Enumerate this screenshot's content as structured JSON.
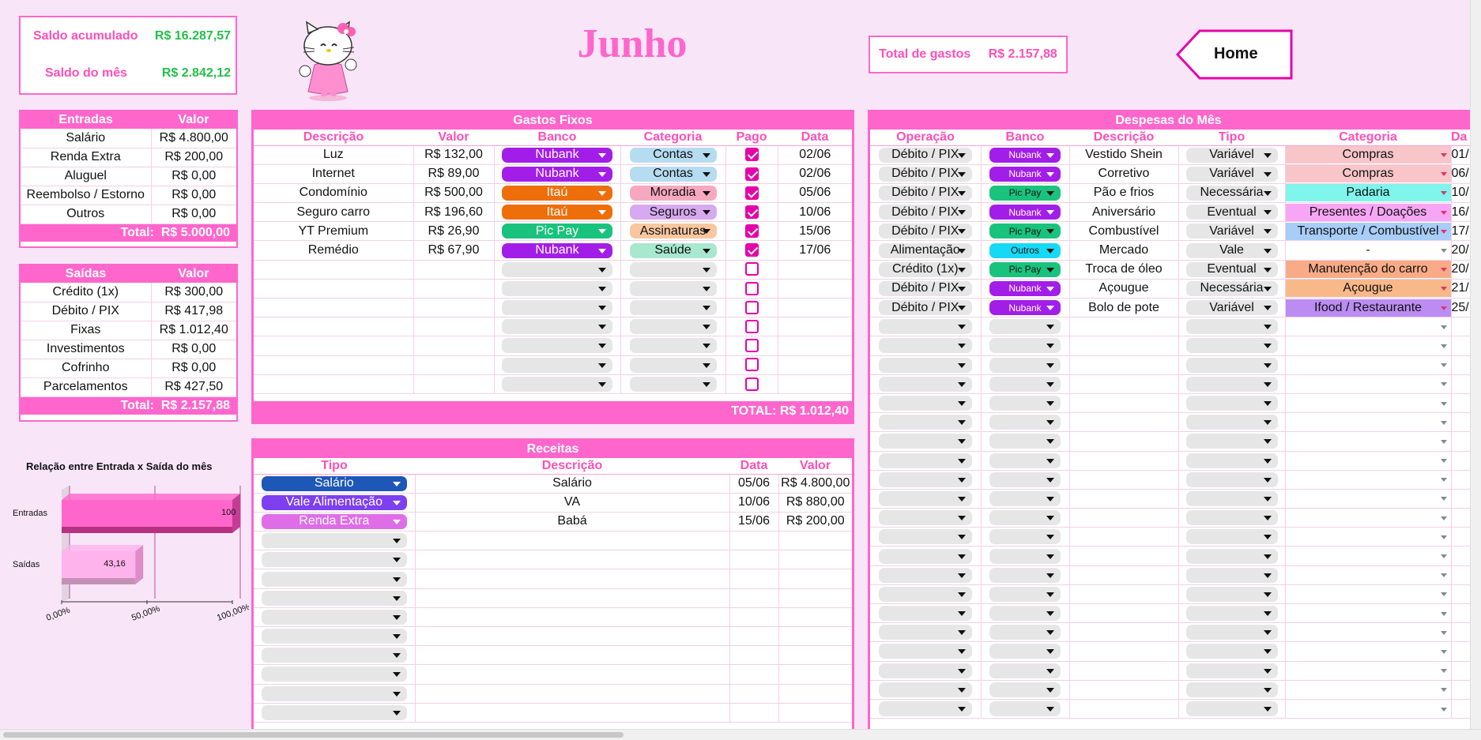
{
  "summary": {
    "saldo_acumulado_label": "Saldo acumulado",
    "saldo_acumulado_value": "R$ 16.287,57",
    "saldo_mes_label": "Saldo do mês",
    "saldo_mes_value": "R$ 2.842,12"
  },
  "month_title": "Junho",
  "total_gastos": {
    "label": "Total de gastos",
    "value": "R$ 2.157,88"
  },
  "home_label": "Home",
  "entradas": {
    "headers": [
      "Entradas",
      "Valor"
    ],
    "rows": [
      [
        "Salário",
        "R$ 4.800,00"
      ],
      [
        "Renda Extra",
        "R$ 200,00"
      ],
      [
        "Aluguel",
        "R$ 0,00"
      ],
      [
        "Reembolso / Estorno",
        "R$ 0,00"
      ],
      [
        "Outros",
        "R$ 0,00"
      ]
    ],
    "total_label": "Total:",
    "total_value": "R$ 5.000,00"
  },
  "saidas": {
    "headers": [
      "Saídas",
      "Valor"
    ],
    "rows": [
      [
        "Crédito (1x)",
        "R$ 300,00"
      ],
      [
        "Débito / PIX",
        "R$ 417,98"
      ],
      [
        "Fixas",
        "R$ 1.012,40"
      ],
      [
        "Investimentos",
        "R$ 0,00"
      ],
      [
        "Cofrinho",
        "R$ 0,00"
      ],
      [
        "Parcelamentos",
        "R$ 427,50"
      ]
    ],
    "total_label": "Total:",
    "total_value": "R$ 2.157,88"
  },
  "chart_data": {
    "type": "bar",
    "orientation": "horizontal",
    "title": "Relação entre Entrada x Saída do mês",
    "categories": [
      "Entradas",
      "Saídas"
    ],
    "values": [
      100,
      43.16
    ],
    "value_labels": [
      "100",
      "43,16"
    ],
    "xlim": [
      0,
      100
    ],
    "x_ticks": [
      "0,00%",
      "50,00%",
      "100,00%"
    ],
    "colors": [
      "#ff66cc",
      "#ffb3ec"
    ],
    "grid": true
  },
  "gastos_fixos": {
    "title": "Gastos Fixos",
    "headers": [
      "Descrição",
      "Valor",
      "Banco",
      "Categoria",
      "Pago",
      "Data"
    ],
    "rows": [
      {
        "desc": "Luz",
        "valor": "R$ 132,00",
        "banco": "Nubank",
        "categoria": "Contas",
        "pago": true,
        "data": "02/06"
      },
      {
        "desc": "Internet",
        "valor": "R$ 89,00",
        "banco": "Nubank",
        "categoria": "Contas",
        "pago": true,
        "data": "02/06"
      },
      {
        "desc": "Condomínio",
        "valor": "R$ 500,00",
        "banco": "Itaú",
        "categoria": "Moradia",
        "pago": true,
        "data": "05/06"
      },
      {
        "desc": "Seguro carro",
        "valor": "R$ 196,60",
        "banco": "Itaú",
        "categoria": "Seguros",
        "pago": true,
        "data": "10/06"
      },
      {
        "desc": "YT Premium",
        "valor": "R$ 26,90",
        "banco": "Pic Pay",
        "categoria": "Assinaturas",
        "pago": true,
        "data": "15/06"
      },
      {
        "desc": "Remédio",
        "valor": "R$ 67,90",
        "banco": "Nubank",
        "categoria": "Saúde",
        "pago": true,
        "data": "17/06"
      }
    ],
    "empty_rows": 7,
    "total_label": "TOTAL:",
    "total_value": "R$ 1.012,40"
  },
  "receitas": {
    "title": "Receitas",
    "headers": [
      "Tipo",
      "Descrição",
      "Data",
      "Valor"
    ],
    "rows": [
      {
        "tipo": "Salário",
        "desc": "Salário",
        "data": "05/06",
        "valor": "R$ 4.800,00"
      },
      {
        "tipo": "Vale Alimentação",
        "desc": "VA",
        "data": "10/06",
        "valor": "R$ 880,00"
      },
      {
        "tipo": "Renda Extra",
        "desc": "Babá",
        "data": "15/06",
        "valor": "R$ 200,00"
      }
    ],
    "empty_rows": 10
  },
  "despesas": {
    "title": "Despesas do Mês",
    "headers": [
      "Operação",
      "Banco",
      "Descrição",
      "Tipo",
      "Categoria",
      "Da"
    ],
    "rows": [
      {
        "op": "Débito / PIX",
        "banco": "Nubank",
        "desc": "Vestido Shein",
        "tipo": "Variável",
        "cat": "Compras",
        "data": "01/"
      },
      {
        "op": "Débito / PIX",
        "banco": "Nubank",
        "desc": "Corretivo",
        "tipo": "Variável",
        "cat": "Compras",
        "data": "06/"
      },
      {
        "op": "Débito / PIX",
        "banco": "Pic Pay",
        "desc": "Pão e frios",
        "tipo": "Necessária",
        "cat": "Padaria",
        "data": "10/"
      },
      {
        "op": "Débito / PIX",
        "banco": "Nubank",
        "desc": "Aniversário",
        "tipo": "Eventual",
        "cat": "Presentes / Doações",
        "data": "16/"
      },
      {
        "op": "Débito / PIX",
        "banco": "Pic Pay",
        "desc": "Combustível",
        "tipo": "Variável",
        "cat": "Transporte / Combustível",
        "data": "17/"
      },
      {
        "op": "Alimentação",
        "banco": "Outros",
        "desc": "Mercado",
        "tipo": "Vale",
        "cat": "-",
        "data": "20/"
      },
      {
        "op": "Crédito (1x)",
        "banco": "Pic Pay",
        "desc": "Troca de óleo",
        "tipo": "Eventual",
        "cat": "Manutenção do carro",
        "data": "20/"
      },
      {
        "op": "Débito / PIX",
        "banco": "Nubank",
        "desc": "Açougue",
        "tipo": "Necessária",
        "cat": "Açougue",
        "data": "21/"
      },
      {
        "op": "Débito / PIX",
        "banco": "Nubank",
        "desc": "Bolo de pote",
        "tipo": "Variável",
        "cat": "Ifood / Restaurante",
        "data": "25/"
      }
    ],
    "empty_rows": 21
  },
  "colors": {
    "accent": "#ff66cc",
    "nubank": "#a21ee8",
    "itau": "#ee6f09",
    "picpay": "#19c37d",
    "outros": "#15d9f5",
    "contas": "#b5dcf1",
    "moradia": "#f7a8c0",
    "seguros": "#d7a9f0",
    "assinaturas": "#f8c79f",
    "saude": "#a7e8cf",
    "salario": "#1d57b8",
    "vale_alimentacao": "#7d3ff0",
    "renda_extra": "#df6de8",
    "compras": "#f8c5c9",
    "padaria": "#7ff5ec",
    "presentes": "#f6a6f4",
    "transporte": "#a7cdf8",
    "manutencao": "#f8ab86",
    "acougue": "#f8b889",
    "ifood": "#bb8cf2",
    "gray_chip": "#e6e6e6"
  },
  "icons": {
    "mascot": "hello-kitty-icon",
    "dropdown": "chevron-down-icon",
    "checkbox": "checkbox-icon",
    "home": "home-arrow-icon"
  }
}
